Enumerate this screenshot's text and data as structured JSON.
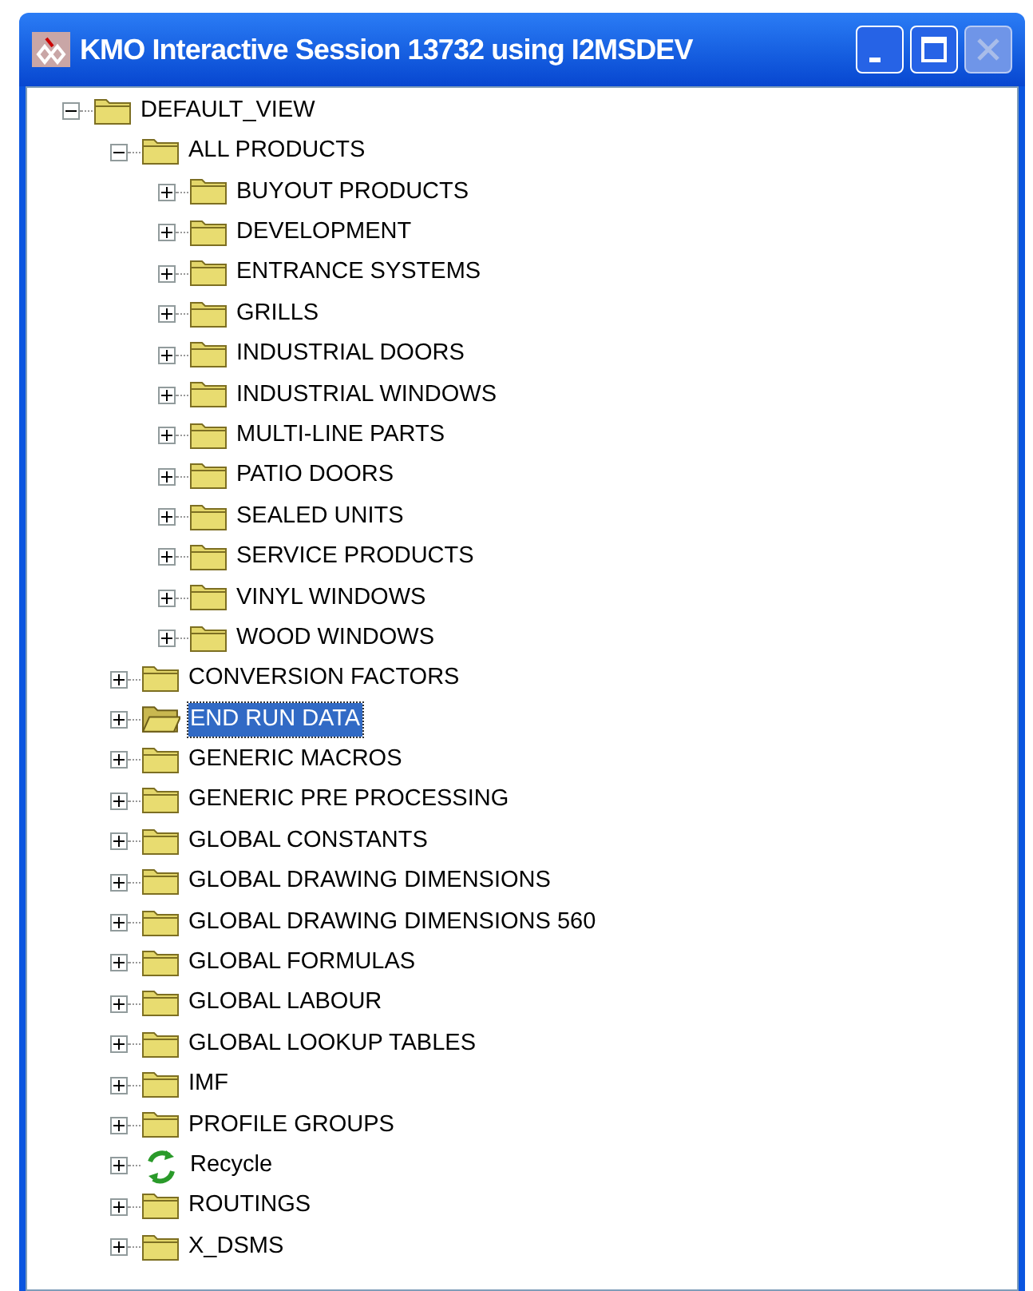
{
  "window": {
    "title": "KMO Interactive Session 13732 using I2MSDEV",
    "buttons": [
      {
        "kind": "minimize",
        "disabled": false
      },
      {
        "kind": "maximize",
        "disabled": false
      },
      {
        "kind": "close",
        "disabled": true
      }
    ]
  },
  "tree": [
    {
      "label": "DEFAULT_VIEW",
      "kind": "folder",
      "expanded": true,
      "selected": false,
      "children": [
        {
          "label": "ALL PRODUCTS",
          "kind": "folder",
          "expanded": true,
          "selected": false,
          "children": [
            {
              "label": "BUYOUT PRODUCTS",
              "kind": "folder",
              "expanded": false,
              "selected": false
            },
            {
              "label": "DEVELOPMENT",
              "kind": "folder",
              "expanded": false,
              "selected": false
            },
            {
              "label": "ENTRANCE SYSTEMS",
              "kind": "folder",
              "expanded": false,
              "selected": false
            },
            {
              "label": "GRILLS",
              "kind": "folder",
              "expanded": false,
              "selected": false
            },
            {
              "label": "INDUSTRIAL DOORS",
              "kind": "folder",
              "expanded": false,
              "selected": false
            },
            {
              "label": "INDUSTRIAL WINDOWS",
              "kind": "folder",
              "expanded": false,
              "selected": false
            },
            {
              "label": "MULTI-LINE PARTS",
              "kind": "folder",
              "expanded": false,
              "selected": false
            },
            {
              "label": "PATIO DOORS",
              "kind": "folder",
              "expanded": false,
              "selected": false
            },
            {
              "label": "SEALED UNITS",
              "kind": "folder",
              "expanded": false,
              "selected": false
            },
            {
              "label": "SERVICE PRODUCTS",
              "kind": "folder",
              "expanded": false,
              "selected": false
            },
            {
              "label": "VINYL WINDOWS",
              "kind": "folder",
              "expanded": false,
              "selected": false
            },
            {
              "label": "WOOD WINDOWS",
              "kind": "folder",
              "expanded": false,
              "selected": false
            }
          ]
        },
        {
          "label": "CONVERSION FACTORS",
          "kind": "folder",
          "expanded": false,
          "selected": false
        },
        {
          "label": "END RUN DATA",
          "kind": "folder",
          "expanded": false,
          "selected": true
        },
        {
          "label": "GENERIC MACROS",
          "kind": "folder",
          "expanded": false,
          "selected": false
        },
        {
          "label": "GENERIC PRE PROCESSING",
          "kind": "folder",
          "expanded": false,
          "selected": false
        },
        {
          "label": "GLOBAL CONSTANTS",
          "kind": "folder",
          "expanded": false,
          "selected": false
        },
        {
          "label": "GLOBAL DRAWING DIMENSIONS",
          "kind": "folder",
          "expanded": false,
          "selected": false
        },
        {
          "label": "GLOBAL DRAWING DIMENSIONS 560",
          "kind": "folder",
          "expanded": false,
          "selected": false
        },
        {
          "label": "GLOBAL FORMULAS",
          "kind": "folder",
          "expanded": false,
          "selected": false
        },
        {
          "label": "GLOBAL LABOUR",
          "kind": "folder",
          "expanded": false,
          "selected": false
        },
        {
          "label": "GLOBAL LOOKUP TABLES",
          "kind": "folder",
          "expanded": false,
          "selected": false
        },
        {
          "label": "IMF",
          "kind": "folder",
          "expanded": false,
          "selected": false
        },
        {
          "label": "PROFILE GROUPS",
          "kind": "folder",
          "expanded": false,
          "selected": false
        },
        {
          "label": "Recycle",
          "kind": "recycle",
          "expanded": false,
          "selected": false
        },
        {
          "label": "ROUTINGS",
          "kind": "folder",
          "expanded": false,
          "selected": false
        },
        {
          "label": "X_DSMS",
          "kind": "folder",
          "expanded": false,
          "selected": false
        }
      ]
    }
  ]
}
